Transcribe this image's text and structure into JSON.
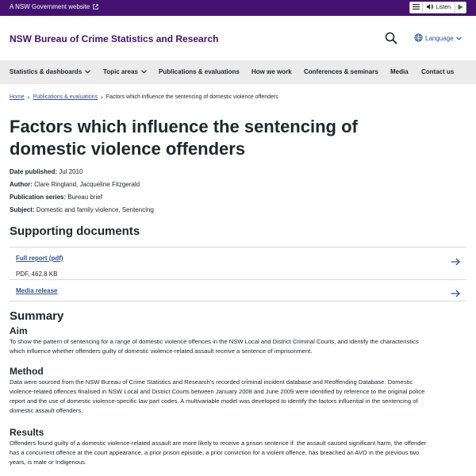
{
  "gov_bar": {
    "link_text": "A NSW Government website",
    "listen_label": "Listen"
  },
  "header": {
    "site_title": "NSW Bureau of Crime Statistics and Research",
    "language_label": "Language"
  },
  "nav": {
    "items": [
      {
        "label": "Statistics & dashboards",
        "has_dropdown": true
      },
      {
        "label": "Topic areas",
        "has_dropdown": true
      },
      {
        "label": "Publications & evaluations",
        "has_dropdown": false
      },
      {
        "label": "How we work",
        "has_dropdown": false
      },
      {
        "label": "Conferences & seminars",
        "has_dropdown": false
      },
      {
        "label": "Media",
        "has_dropdown": false
      },
      {
        "label": "Contact us",
        "has_dropdown": false
      }
    ]
  },
  "breadcrumb": {
    "home": "Home",
    "section": "Publications & evaluations",
    "current": "Factors which influence the sentencing of domestic violence offenders"
  },
  "page": {
    "title_line1": "Factors which influence the sentencing of",
    "title_line2": "domestic violence offenders",
    "meta": [
      {
        "label": "Date published:",
        "value": "Jul 2010"
      },
      {
        "label": "Author:",
        "value": "Clare Ringland, Jacqueline Fitzgerald"
      },
      {
        "label": "Publication series:",
        "value": "Bureau brief"
      },
      {
        "label": "Subject:",
        "value": "Domestic and family violence, Sentencing"
      }
    ]
  },
  "supporting": {
    "heading": "Supporting documents",
    "docs": [
      {
        "label": "Full report (pdf)",
        "info": "PDF, 462.8 KB"
      },
      {
        "label": "Media release"
      }
    ]
  },
  "summary": {
    "heading": "Summary",
    "aim_heading": "Aim",
    "aim_line1": "To show the pattern of sentencing for a range of domestic violence offences in the NSW Local and District Criminal Courts, and identify the characteristics",
    "aim_line2": "which influence whether offenders guilty of domestic violence-related assault receive a sentence of imprisonment.",
    "method_heading": "Method",
    "method_line1": "Data were sourced from the NSW Bureau of Crime Statistics and Research's recorded criminal incident database and Reoffending Database. Domestic",
    "method_line2": "violence-related offences finalised in NSW Local and District Courts between January 2008 and June 2009 were identified by reference to the original police",
    "method_line3": "report and the use of domestic violence-specific law part codes. A multivariable model was developed to identify the factors influential in the sentencing of",
    "method_line4": "domestic assault offenders.",
    "results_heading": "Results",
    "results_line1": "Offenders found guilty of a domestic violence-related assault are more likely to receive a prison sentence if: the assault caused significant harm, the offender",
    "results_line2": "has a concurrent offence at the court appearance, a prior prison episode, a prior conviction for a violent offence, has breached an AVO in the previous two",
    "results_line3": "years, is male or Indigenous."
  },
  "colors": {
    "brand": "#441170",
    "link": "#2e5299",
    "nav_bg": "#ebebeb",
    "text": "#22272b"
  },
  "icons": [
    "external-link-icon",
    "menu-icon",
    "speaker-icon",
    "play-icon",
    "search-icon",
    "globe-icon",
    "chevron-down-icon",
    "chevron-right-icon",
    "arrow-right-icon"
  ]
}
